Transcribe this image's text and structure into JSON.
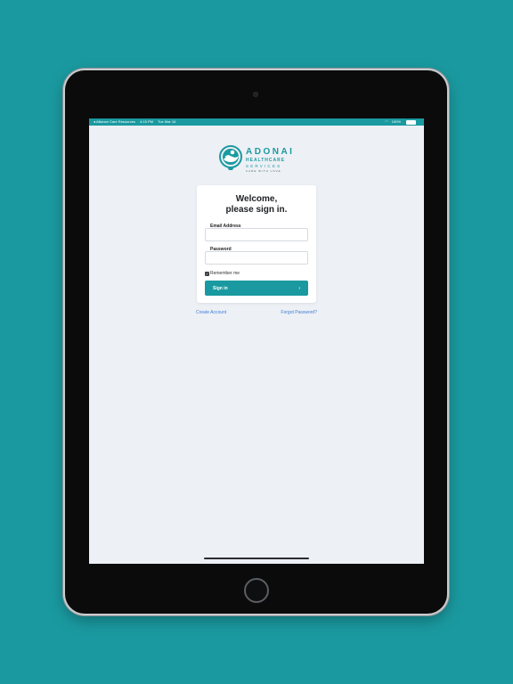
{
  "status_bar": {
    "back_label": "◂ Alliance Care Resources",
    "time": "4:15 PM",
    "date": "Tue Mar 16",
    "battery": "100%"
  },
  "logo": {
    "word": "ADONAI",
    "line1": "HEALTHCARE",
    "line2": "SERVICES",
    "tagline": "CARE WITH LOVE"
  },
  "login": {
    "title_line1": "Welcome,",
    "title_line2": "please sign in.",
    "email_label": "Email Address",
    "email_value": "",
    "password_label": "Password",
    "password_value": "",
    "remember_label": "Remember me",
    "remember_checked": true,
    "signin_label": "Sign in"
  },
  "links": {
    "create_account": "Create Account",
    "forgot_password": "Forgot Password?"
  },
  "colors": {
    "brand_teal": "#1a9aa0",
    "link_blue": "#3f7fd6",
    "screen_bg": "#edf0f5"
  }
}
